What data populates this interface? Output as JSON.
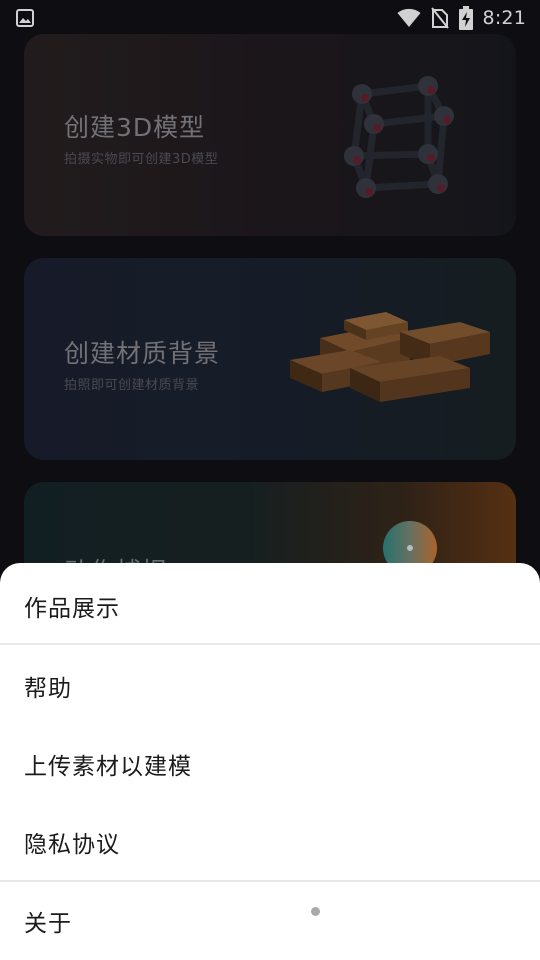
{
  "status_bar": {
    "time": "8:21",
    "icons": [
      "image-icon",
      "wifi-icon",
      "no-sim-icon",
      "battery-charging-icon"
    ]
  },
  "cards": [
    {
      "title": "创建3D模型",
      "subtitle": "拍摄实物即可创建3D模型",
      "illustration": "cube-molecule-icon"
    },
    {
      "title": "创建材质背景",
      "subtitle": "拍照即可创建材质背景",
      "illustration": "wooden-blocks-icon"
    },
    {
      "title": "动作捕捉",
      "illustration": "sphere-icon"
    }
  ],
  "menu": {
    "items": [
      {
        "label": "作品展示"
      },
      {
        "label": "帮助"
      },
      {
        "label": "上传素材以建模"
      },
      {
        "label": "隐私协议"
      },
      {
        "label": "关于"
      }
    ]
  },
  "colors": {
    "background": "#121217",
    "sheet": "#ffffff",
    "menu_text": "#1b1b1b",
    "card_title": "#8a8a90"
  }
}
